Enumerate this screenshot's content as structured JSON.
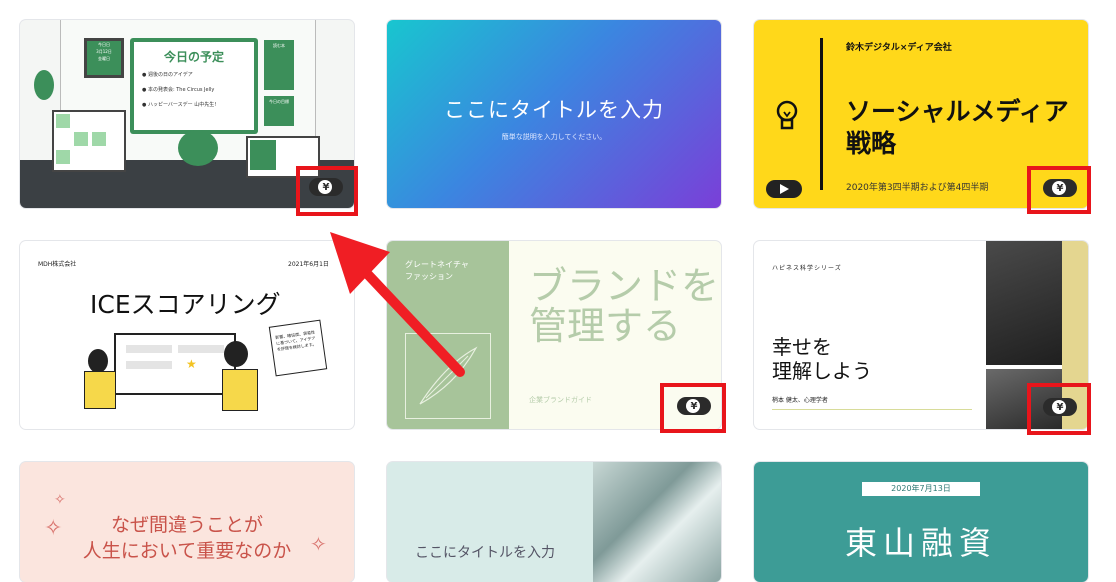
{
  "badges": {
    "yen": "¥"
  },
  "card1": {
    "title": "今日の予定",
    "items": [
      "週後の日のアイデア",
      "本の発表会: The Circus Jelly",
      "ハッピーバースデー 山中先生!"
    ],
    "calendar": [
      "今日日",
      "3月12日",
      "金曜日"
    ],
    "note_head": "読む本",
    "note2_head": "今日の目標"
  },
  "card2": {
    "title": "ここにタイトルを入力",
    "subtitle": "簡単な説明を入力してください。"
  },
  "card3": {
    "company": "鈴木デジタル×ディア会社",
    "title1": "ソーシャルメディア",
    "title2": "戦略",
    "footer": "2020年第3四半期および第4四半期"
  },
  "card4": {
    "company": "MDH株式会社",
    "date": "2021年6月1日",
    "title": "ICEスコアリング",
    "note": "影響、確信度、容易性に基づいて、アイデアを評価を検討します。"
  },
  "card5": {
    "label1": "グレートネイチャ",
    "label2": "ファッション",
    "title1": "ブランドを",
    "title2": "管理する",
    "footer": "企業ブランドガイド"
  },
  "card6": {
    "series": "ハピネス科学シリーズ",
    "title1": "幸せを",
    "title2": "理解しよう",
    "author": "梢本 健太、心理学者"
  },
  "card7": {
    "title1": "なぜ間違うことが",
    "title2": "人生において重要なのか"
  },
  "card8": {
    "title": "ここにタイトルを入力"
  },
  "card9": {
    "date": "2020年7月13日",
    "title": "東山融資"
  }
}
